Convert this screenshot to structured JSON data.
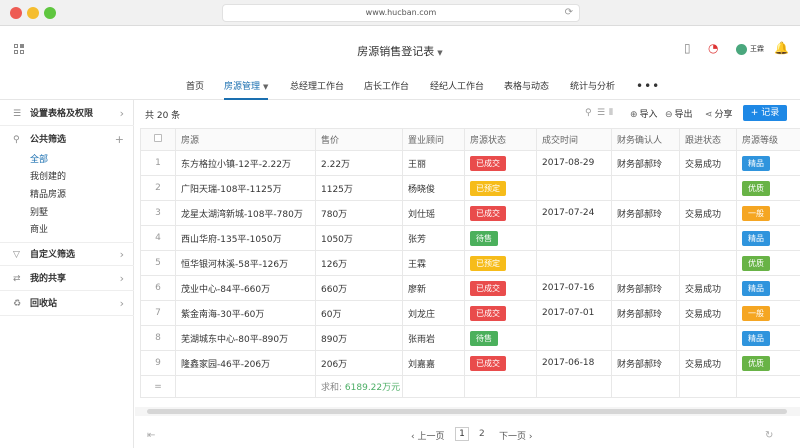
{
  "browser": {
    "url": "www.hucban.com"
  },
  "app": {
    "title": "房源销售登记表",
    "user": "王霖"
  },
  "nav": [
    "首页",
    "房源管理",
    "总经理工作台",
    "店长工作台",
    "经纪人工作台",
    "表格与动态",
    "统计与分析"
  ],
  "sidebar": {
    "settings": "设置表格及权限",
    "filter_title": "公共筛选",
    "filters": [
      "全部",
      "我创建的",
      "精品房源",
      "别墅",
      "商业"
    ],
    "custom": "自定义筛选",
    "share": "我的共享",
    "recycle": "回收站"
  },
  "toolbar": {
    "total": "共 20 条",
    "import": "导入",
    "export": "导出",
    "share": "分享",
    "add": "+ 记录"
  },
  "table": {
    "headers": [
      "房源",
      "售价",
      "置业顾问",
      "房源状态",
      "成交时间",
      "财务确认人",
      "跟进状态",
      "房源等级"
    ],
    "rows": [
      {
        "no": "1",
        "name": "东方格拉小镇-12平-2.22万",
        "price": "2.22万",
        "agent": "王丽",
        "status": "已成交",
        "status_type": "sold",
        "date": "2017-08-29",
        "finance": "财务部郝玲",
        "follow": "交易成功",
        "grade": "精品",
        "grade_type": "jing"
      },
      {
        "no": "2",
        "name": "广阳天瑞-108平-1125万",
        "price": "1125万",
        "agent": "杨晓俊",
        "status": "已预定",
        "status_type": "reserved",
        "date": "",
        "finance": "",
        "follow": "",
        "grade": "优质",
        "grade_type": "you"
      },
      {
        "no": "3",
        "name": "龙星太湖湾新城-108平-780万",
        "price": "780万",
        "agent": "刘仕瑶",
        "status": "已成交",
        "status_type": "sold",
        "date": "2017-07-24",
        "finance": "财务部郝玲",
        "follow": "交易成功",
        "grade": "一般",
        "grade_type": "yiban"
      },
      {
        "no": "4",
        "name": "西山华府-135平-1050万",
        "price": "1050万",
        "agent": "张芳",
        "status": "待售",
        "status_type": "forsale",
        "date": "",
        "finance": "",
        "follow": "",
        "grade": "精品",
        "grade_type": "jing"
      },
      {
        "no": "5",
        "name": "恒华银河林溪-58平-126万",
        "price": "126万",
        "agent": "王霖",
        "status": "已预定",
        "status_type": "reserved",
        "date": "",
        "finance": "",
        "follow": "",
        "grade": "优质",
        "grade_type": "you"
      },
      {
        "no": "6",
        "name": "茂业中心-84平-660万",
        "price": "660万",
        "agent": "廖新",
        "status": "已成交",
        "status_type": "sold",
        "date": "2017-07-16",
        "finance": "财务部郝玲",
        "follow": "交易成功",
        "grade": "精品",
        "grade_type": "jing"
      },
      {
        "no": "7",
        "name": "紫金南海-30平-60万",
        "price": "60万",
        "agent": "刘龙庄",
        "status": "已成交",
        "status_type": "sold",
        "date": "2017-07-01",
        "finance": "财务部郝玲",
        "follow": "交易成功",
        "grade": "一般",
        "grade_type": "yiban"
      },
      {
        "no": "8",
        "name": "芜湖城东中心-80平-890万",
        "price": "890万",
        "agent": "张雨岩",
        "status": "待售",
        "status_type": "forsale",
        "date": "",
        "finance": "",
        "follow": "",
        "grade": "精品",
        "grade_type": "jing"
      },
      {
        "no": "9",
        "name": "隆鑫家园-46平-206万",
        "price": "206万",
        "agent": "刘嘉嘉",
        "status": "已成交",
        "status_type": "sold",
        "date": "2017-06-18",
        "finance": "财务部郝玲",
        "follow": "交易成功",
        "grade": "优质",
        "grade_type": "you"
      }
    ],
    "sum_marker": "=",
    "sum_label": "求和:",
    "sum_value": "6189.22万元"
  },
  "pagination": {
    "prev": "上一页",
    "pages": [
      "1",
      "2"
    ],
    "next": "下一页"
  }
}
